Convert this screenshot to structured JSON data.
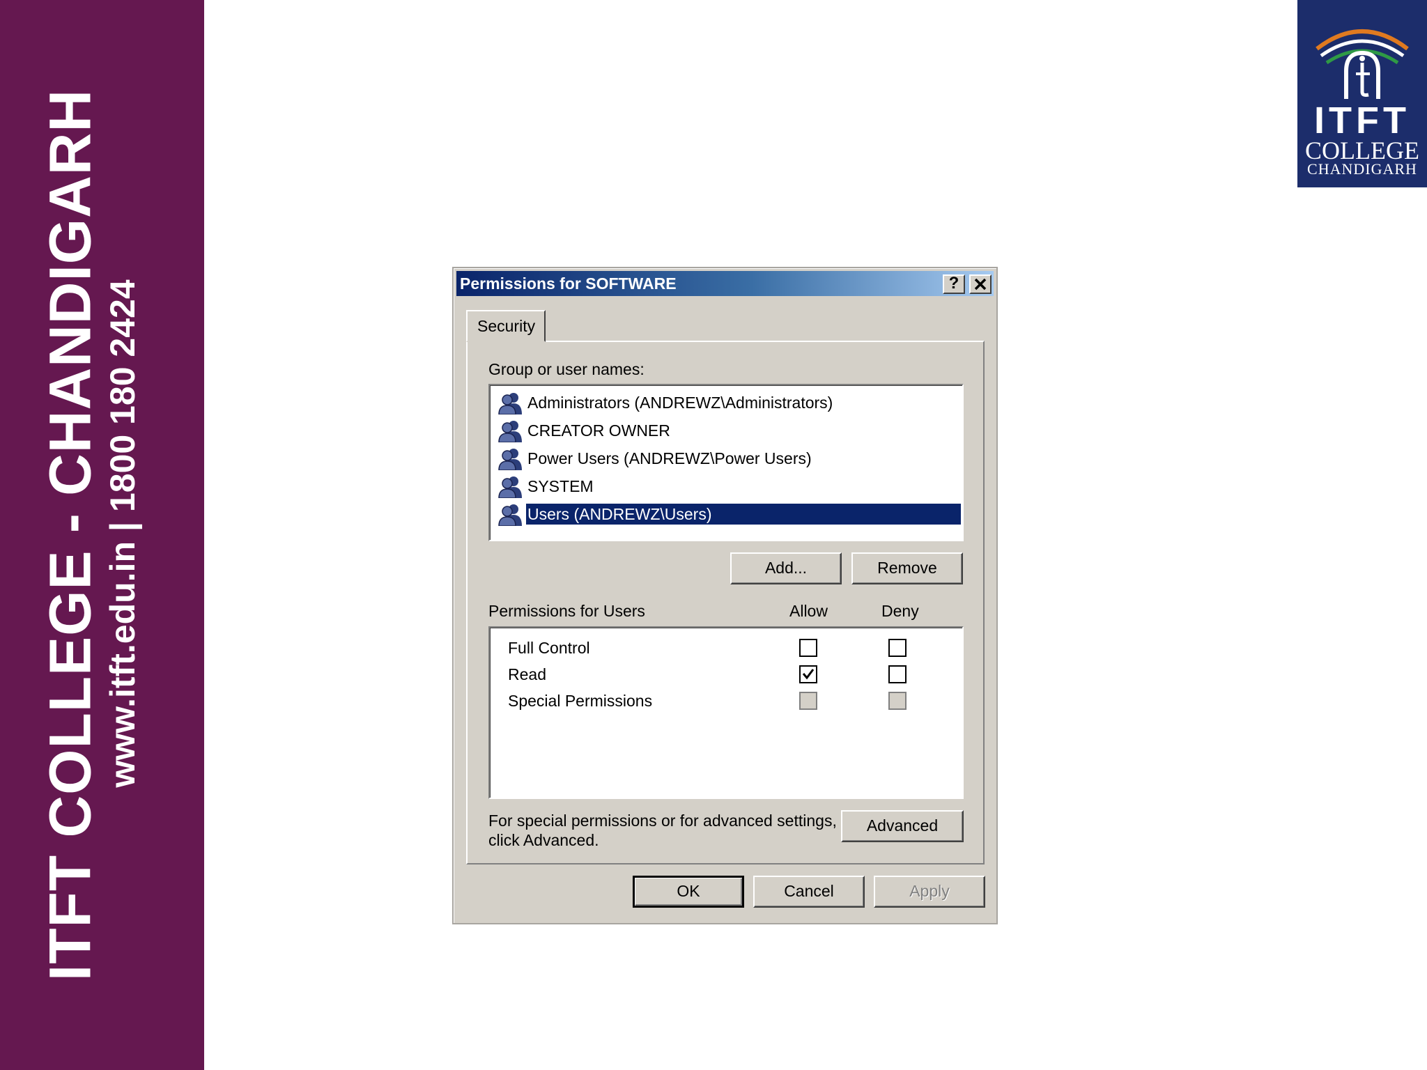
{
  "banner": {
    "college": "ITFT COLLEGE - CHANDIGARH",
    "website": "www.itft.edu.in",
    "separator": "|",
    "phone": "1800 180 2424"
  },
  "logo": {
    "brand": "ITFT",
    "line1": "COLLEGE",
    "line2": "CHANDIGARH"
  },
  "dialog": {
    "title": "Permissions for SOFTWARE",
    "help_button": "?",
    "close_button": "✕",
    "tab": "Security",
    "group_label": "Group or user names:",
    "users": [
      {
        "name": "Administrators (ANDREWZ\\Administrators)",
        "selected": false
      },
      {
        "name": "CREATOR OWNER",
        "selected": false
      },
      {
        "name": "Power Users (ANDREWZ\\Power Users)",
        "selected": false
      },
      {
        "name": "SYSTEM",
        "selected": false
      },
      {
        "name": "Users (ANDREWZ\\Users)",
        "selected": true
      }
    ],
    "add_button": "Add...",
    "remove_button": "Remove",
    "permissions_label": "Permissions for Users",
    "allow_header": "Allow",
    "deny_header": "Deny",
    "permissions": [
      {
        "name": "Full Control",
        "allow": false,
        "deny": false,
        "disabled": false
      },
      {
        "name": "Read",
        "allow": true,
        "deny": false,
        "disabled": false
      },
      {
        "name": "Special Permissions",
        "allow": false,
        "deny": false,
        "disabled": true
      }
    ],
    "advanced_note_1": "For special permissions or for advanced settings,",
    "advanced_note_2": "click Advanced.",
    "advanced_button": "Advanced",
    "ok_button": "OK",
    "cancel_button": "Cancel",
    "apply_button": "Apply"
  },
  "colors": {
    "banner": "#651850",
    "logo_bg": "#1c2d6b",
    "dialog_face": "#d4d0c8",
    "selection": "#0a246a",
    "title_gradient_start": "#0a246a",
    "title_gradient_end": "#a6caf0"
  },
  "icons": {
    "user_group": "users-group-icon",
    "check": "checkmark-icon"
  }
}
